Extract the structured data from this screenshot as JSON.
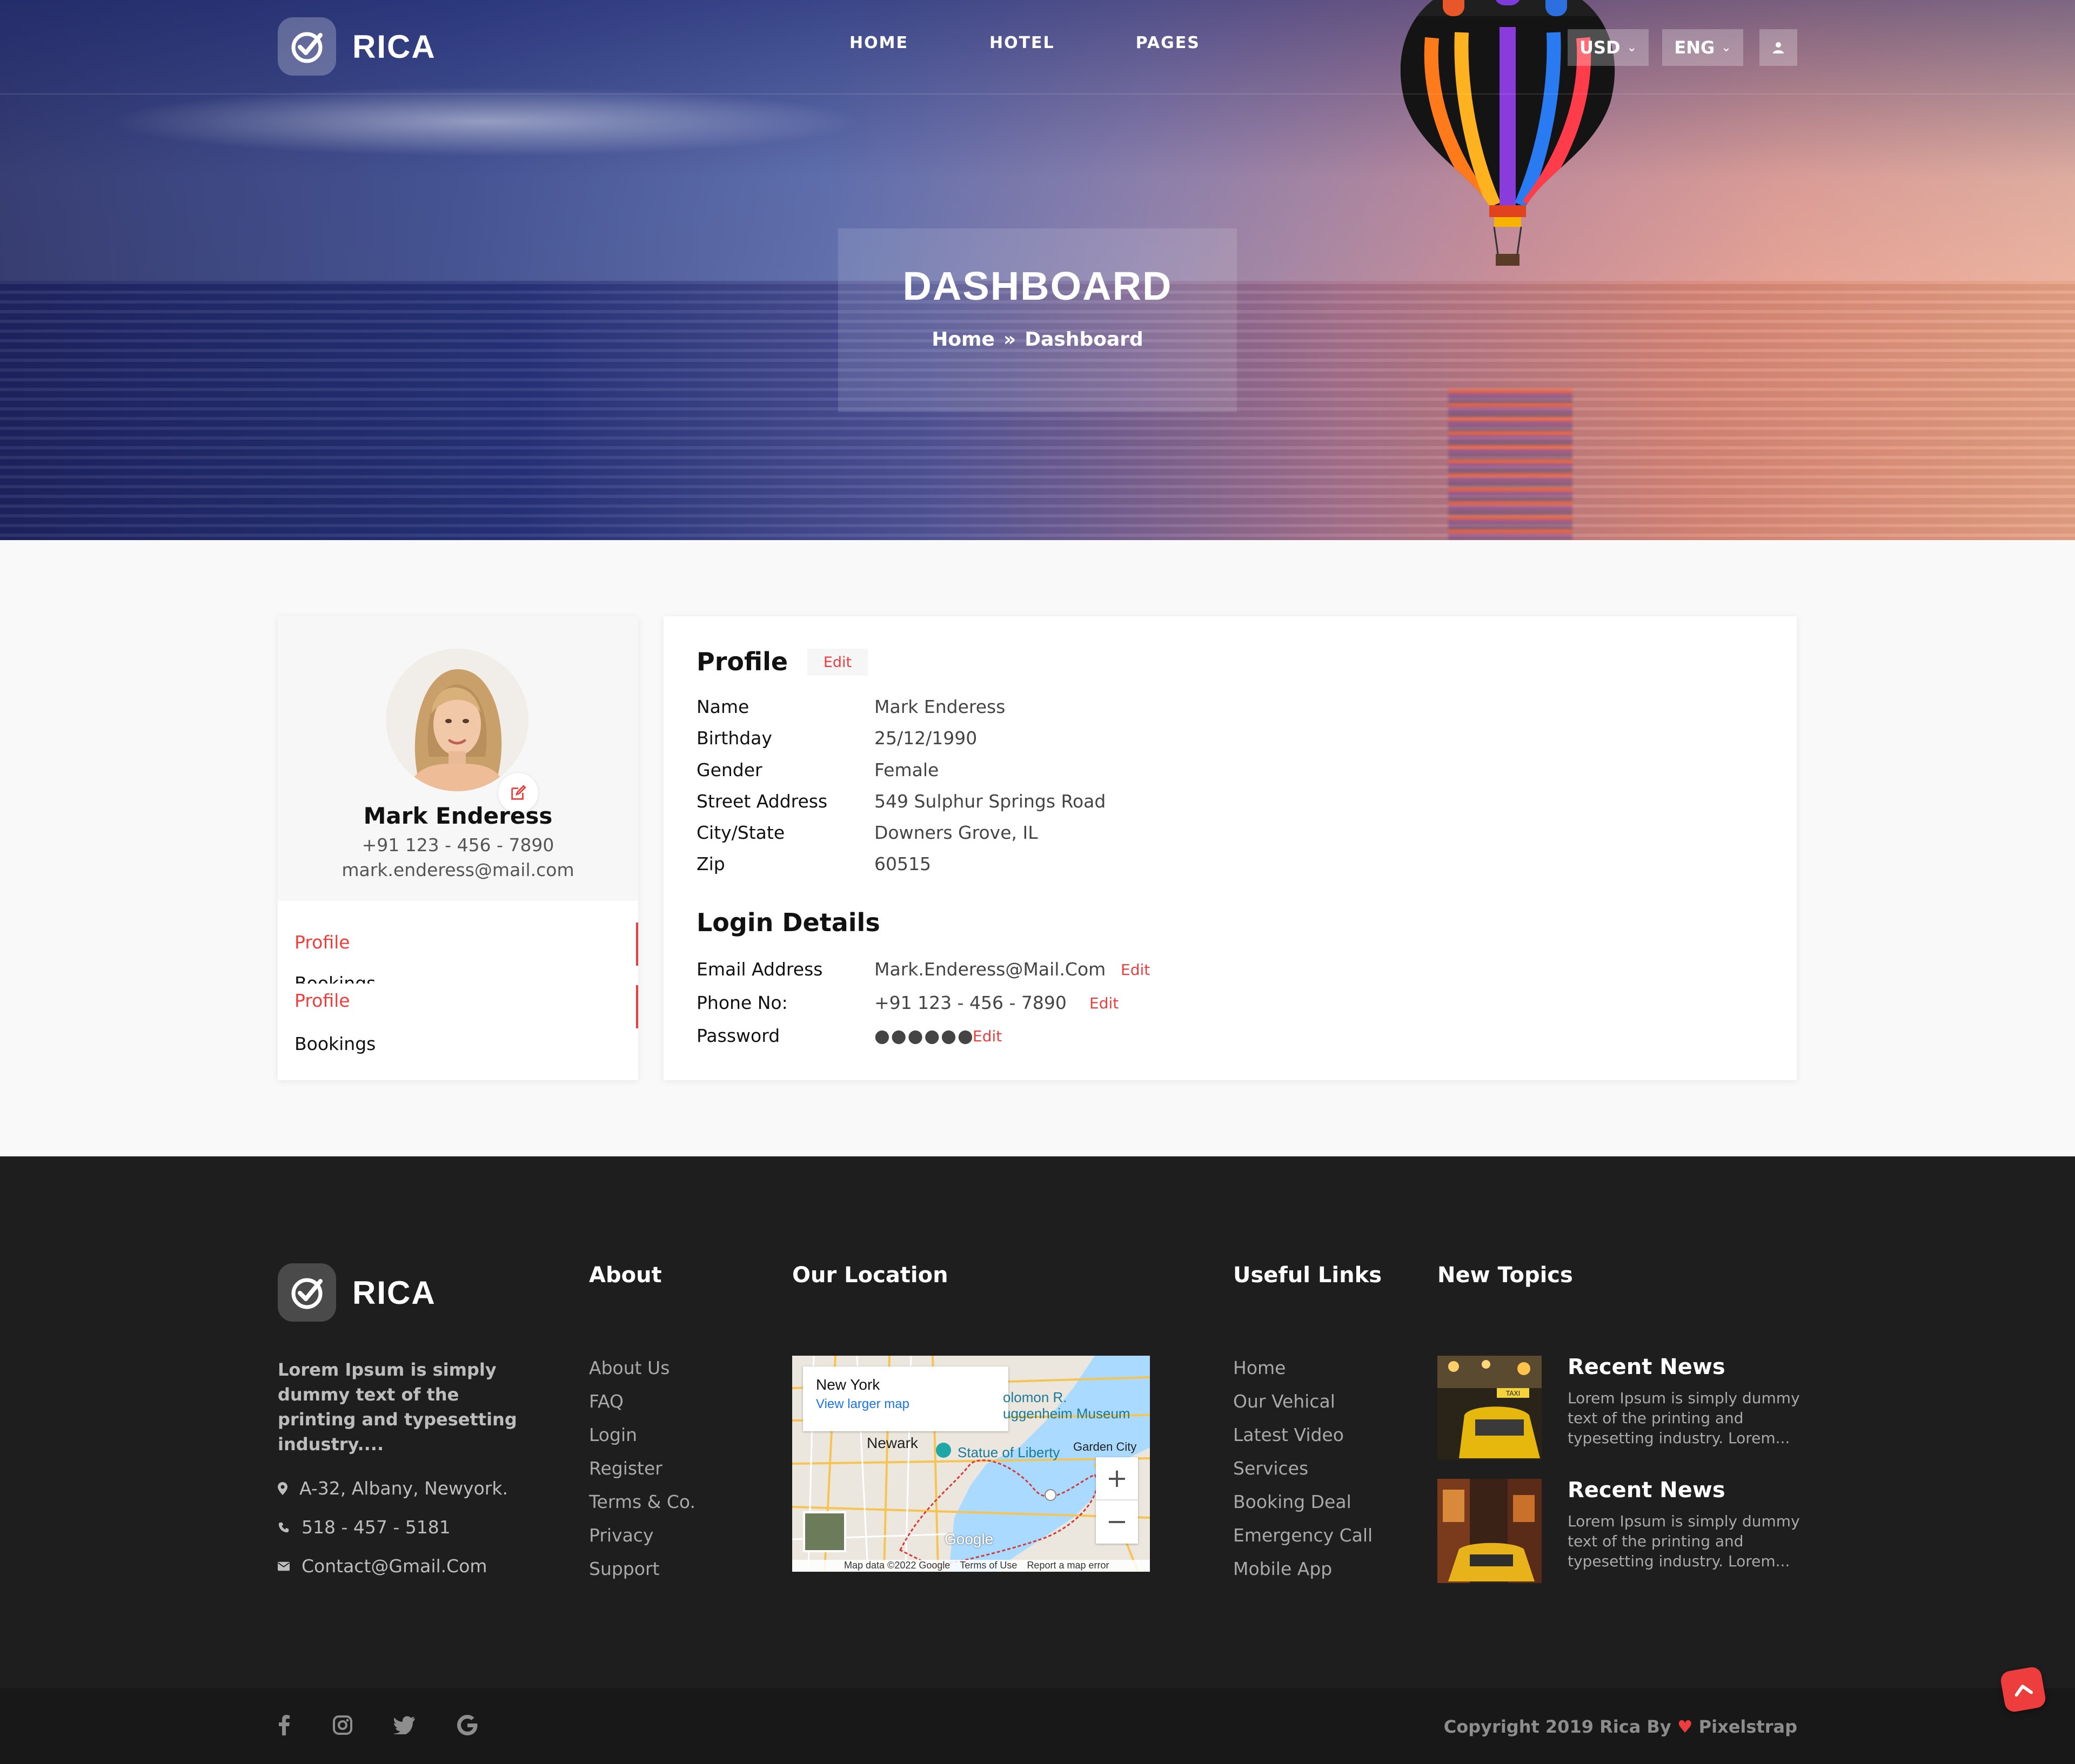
{
  "brand": {
    "name": "RICA"
  },
  "nav": {
    "items": [
      "HOME",
      "HOTEL",
      "PAGES"
    ]
  },
  "header": {
    "currency": "USD",
    "language": "ENG"
  },
  "hero": {
    "title": "DASHBOARD",
    "breadcrumb": [
      "Home",
      "Dashboard"
    ]
  },
  "user": {
    "name": "Mark Enderess",
    "phone": "+91 123 - 456 - 7890",
    "email": "mark.enderess@mail.com"
  },
  "sidebar": {
    "items": [
      "Profile",
      "Bookings",
      "Profile",
      "Bookings"
    ]
  },
  "profile": {
    "title": "Profile",
    "edit_label": "Edit",
    "rows": [
      {
        "label": "Name",
        "value": "Mark Enderess"
      },
      {
        "label": "Birthday",
        "value": "25/12/1990"
      },
      {
        "label": "Gender",
        "value": "Female"
      },
      {
        "label": "Street Address",
        "value": "549 Sulphur Springs Road"
      },
      {
        "label": "City/State",
        "value": "Downers Grove, IL"
      },
      {
        "label": "Zip",
        "value": "60515"
      }
    ]
  },
  "login": {
    "title": "Login Details",
    "rows": [
      {
        "label": "Email Address",
        "value": "Mark.Enderess@Mail.Com",
        "edit": "Edit"
      },
      {
        "label": "Phone No:",
        "value": "+91 123 - 456 - 7890",
        "edit": "Edit"
      },
      {
        "label": "Password",
        "value": "●●●●●●",
        "edit": "Edit"
      }
    ]
  },
  "footer": {
    "brand": "RICA",
    "about_text": "Lorem Ipsum is simply dummy text of the printing and typesetting industry....",
    "contact": {
      "address": "A-32, Albany, Newyork.",
      "phone": "518 - 457 - 5181",
      "email": "Contact@Gmail.Com"
    },
    "about": {
      "heading": "About",
      "links": [
        "About Us",
        "FAQ",
        "Login",
        "Register",
        "Terms & Co.",
        "Privacy",
        "Support"
      ]
    },
    "location": {
      "heading": "Our Location",
      "map": {
        "place": "New York",
        "larger_map": "View larger map",
        "labels": [
          "Newark",
          "Statue of Liberty",
          "Garden City",
          "olomon R.",
          "uggenheim Museum"
        ],
        "google": "Google",
        "attribution": [
          "Map data ©2022 Google",
          "Terms of Use",
          "Report a map error"
        ],
        "zoom_in": "+",
        "zoom_out": "−"
      }
    },
    "useful": {
      "heading": "Useful Links",
      "links": [
        "Home",
        "Our Vehical",
        "Latest Video",
        "Services",
        "Booking Deal",
        "Emergency Call",
        "Mobile App"
      ]
    },
    "topics": {
      "heading": "New Topics",
      "items": [
        {
          "title": "Recent News",
          "text": "Lorem Ipsum is simply dummy text of the printing and typesetting industry. Lorem..."
        },
        {
          "title": "Recent News",
          "text": "Lorem Ipsum is simply dummy text of the printing and typesetting industry. Lorem..."
        }
      ]
    },
    "social_icons": [
      "facebook-icon",
      "instagram-icon",
      "twitter-icon",
      "google-icon"
    ],
    "copyright_before": "Copyright 2019 Rica By",
    "copyright_after": "Pixelstrap"
  },
  "colors": {
    "accent": "#ee3d3d",
    "footer_bg": "#1e1e1e"
  }
}
